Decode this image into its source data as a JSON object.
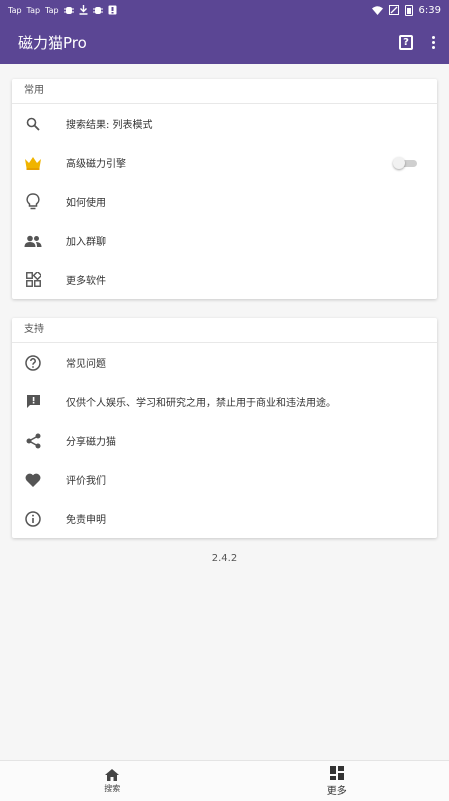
{
  "status_bar": {
    "left_items": [
      "Tap",
      "Tap",
      "Tap"
    ],
    "time": "6:39"
  },
  "app_bar": {
    "title": "磁力猫Pro",
    "help_icon": "help-book-icon",
    "more_icon": "more-vert-icon",
    "color": "#5b4694"
  },
  "sections": [
    {
      "header": "常用",
      "items": [
        {
          "icon": "search-icon",
          "label": "搜索结果: 列表模式"
        },
        {
          "icon": "crown-icon",
          "label": "高级磁力引擎",
          "toggle": false
        },
        {
          "icon": "lightbulb-icon",
          "label": "如何使用"
        },
        {
          "icon": "group-icon",
          "label": "加入群聊"
        },
        {
          "icon": "apps-grid-icon",
          "label": "更多软件"
        }
      ]
    },
    {
      "header": "支持",
      "items": [
        {
          "icon": "help-circle-icon",
          "label": "常见问题"
        },
        {
          "icon": "feedback-icon",
          "label": "仅供个人娱乐、学习和研究之用，禁止用于商业和违法用途。"
        },
        {
          "icon": "share-icon",
          "label": "分享磁力猫"
        },
        {
          "icon": "heart-icon",
          "label": "评价我们"
        },
        {
          "icon": "info-icon",
          "label": "免责申明"
        }
      ]
    }
  ],
  "version": "2.4.2",
  "bottom_nav": [
    {
      "icon": "home-icon",
      "label": "搜索"
    },
    {
      "icon": "dashboard-icon",
      "label": "更多",
      "active": true
    }
  ]
}
